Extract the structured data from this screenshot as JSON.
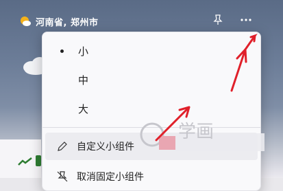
{
  "widget": {
    "location": "河南省, 郑州市",
    "icons": {
      "weather": "partly-sunny-icon",
      "pin": "pin-icon",
      "more": "more-options-icon",
      "cloud": "cloud-icon",
      "trend": "trend-up-icon"
    },
    "accent": "#f5b21a"
  },
  "menu": {
    "size_options": [
      {
        "label": "小",
        "selected": true
      },
      {
        "label": "中",
        "selected": false
      },
      {
        "label": "大",
        "selected": false
      }
    ],
    "actions": [
      {
        "label": "自定义小组件",
        "icon": "pencil-icon"
      },
      {
        "label": "取消固定小组件",
        "icon": "unpin-icon"
      }
    ]
  },
  "watermark": {
    "text": "学画",
    "colors": [
      "#e9a6b2",
      "#c5c5cc"
    ]
  },
  "annotation_color": "#e0202a"
}
